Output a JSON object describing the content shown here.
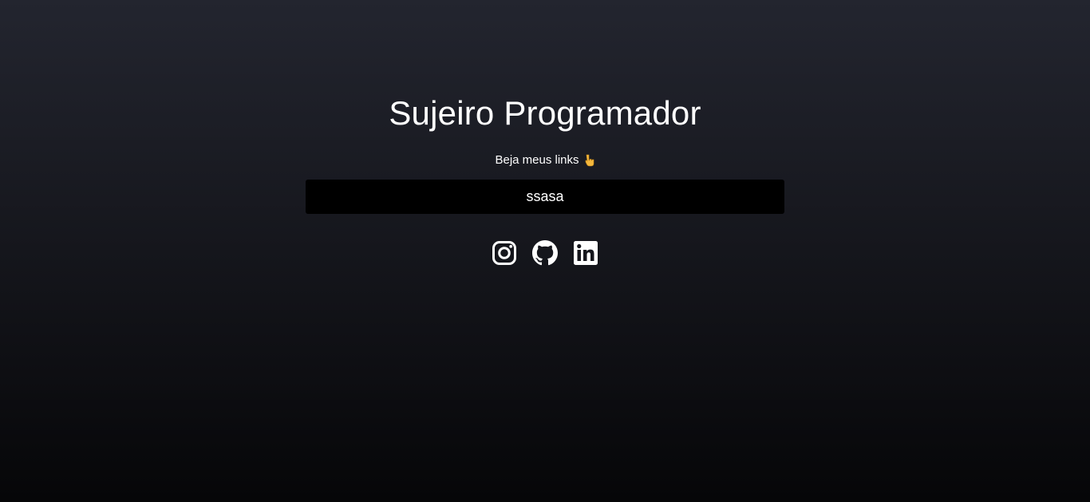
{
  "header": {
    "title": "Sujeiro Programador",
    "subtitle": "Beja meus links"
  },
  "links": [
    {
      "label": "ssasa"
    }
  ],
  "social": {
    "icons": [
      "instagram-icon",
      "github-icon",
      "linkedin-icon"
    ]
  },
  "colors": {
    "background_top": "#23252f",
    "background_bottom": "#060608",
    "button_bg": "#000000",
    "text": "#ffffff",
    "emoji": "#f5b83d"
  }
}
